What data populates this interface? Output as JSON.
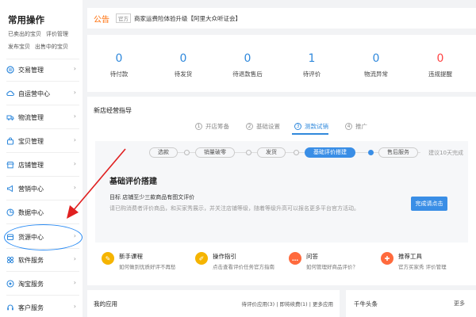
{
  "sidebar": {
    "title": "常用操作",
    "quick_row1": [
      "已卖出的宝贝",
      "评价管理"
    ],
    "quick_row2": [
      "发布宝贝",
      "出售中的宝贝"
    ],
    "items": [
      {
        "label": "交易管理",
        "icon": "exchange-icon"
      },
      {
        "label": "自运营中心",
        "icon": "cloud-icon"
      },
      {
        "label": "物流管理",
        "icon": "truck-icon"
      },
      {
        "label": "宝贝管理",
        "icon": "bag-icon"
      },
      {
        "label": "店铺管理",
        "icon": "store-icon"
      },
      {
        "label": "营销中心",
        "icon": "megaphone-icon"
      },
      {
        "label": "数据中心",
        "icon": "chart-icon"
      },
      {
        "label": "货源中心",
        "icon": "box-icon"
      },
      {
        "label": "软件服务",
        "icon": "grid-icon"
      },
      {
        "label": "淘宝服务",
        "icon": "taobao-icon"
      },
      {
        "label": "客户服务",
        "icon": "headset-icon"
      }
    ],
    "chevron": "›"
  },
  "notice": {
    "label": "公告",
    "badge": "官方",
    "text": "商家运费险体验升级【阿里大众听证会】"
  },
  "stats": [
    {
      "value": "0",
      "label": "待付款"
    },
    {
      "value": "0",
      "label": "待发货"
    },
    {
      "value": "0",
      "label": "待退款售后"
    },
    {
      "value": "1",
      "label": "待评价"
    },
    {
      "value": "0",
      "label": "物流异常"
    },
    {
      "value": "0",
      "label": "违规提醒",
      "color": "#ff4444"
    }
  ],
  "guide": {
    "title": "新店经营指导",
    "phases": [
      {
        "label": "开店筹备",
        "num": "1"
      },
      {
        "label": "基础设置",
        "num": "2"
      },
      {
        "label": "测款试销",
        "num": "3"
      },
      {
        "label": "推广",
        "num": "4"
      }
    ],
    "steps": [
      "选款",
      "销量破零",
      "发货",
      "基础评价搭建",
      "售后服务"
    ],
    "suggest": "建议10天完成",
    "inner_title": "基础评价搭建",
    "goal": "目标 店铺至少三款商品有图文评价",
    "desc": "请已购消费者评价商品，和买家秀展示，并关注店铺等级，随着等级升高可以报名更多平台官方活动。",
    "button": "完成请点击",
    "features": [
      {
        "title": "新手课程",
        "sub": "如何做到优质好评不再愁",
        "color": "#f5b400",
        "icon": "bulb-icon",
        "glyph": "✎"
      },
      {
        "title": "操作指引",
        "sub": "点击查看评价任务官方指南",
        "color": "#f5b400",
        "icon": "pencil-icon",
        "glyph": "✐"
      },
      {
        "title": "问答",
        "sub": "如何管理好商品评价？",
        "color": "#ff6a3d",
        "icon": "chat-icon",
        "glyph": "…"
      },
      {
        "title": "推荐工具",
        "sub": "官方买家秀 评价管理",
        "color": "#ff6a3d",
        "icon": "wrench-icon",
        "glyph": "✚"
      }
    ]
  },
  "apps": {
    "title": "我的应用",
    "links": "待评价应用(3) | 即将续费(1) | 更多应用"
  },
  "news": {
    "title": "千牛头条",
    "more": "更多"
  },
  "colors": {
    "accent": "#3089dc",
    "notice": "#ff6a00",
    "annotation": "#e02020",
    "highlight": "#2b8cf4"
  }
}
